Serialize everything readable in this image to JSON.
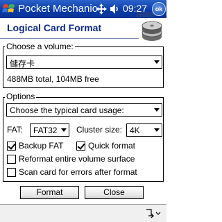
{
  "taskbar": {
    "app_title": "Pocket Mechanic",
    "clock": "09:27",
    "ok_label": "ok"
  },
  "header": {
    "title": "Logical Card Format"
  },
  "volume_group": {
    "legend": "Choose a volume:",
    "selected_volume": "儲存卡",
    "info": "488MB total, 104MB free"
  },
  "options_group": {
    "legend": "Options",
    "usage_select": "Choose the typical card usage:",
    "fat_label": "FAT:",
    "fat_value": "FAT32",
    "cluster_label": "Cluster size:",
    "cluster_value": "4K",
    "backup_fat": {
      "label": "Backup FAT",
      "checked": true
    },
    "quick_format": {
      "label": "Quick format",
      "checked": true
    },
    "reformat_surface": {
      "label": "Reformat entire volume surface",
      "checked": false
    },
    "scan_errors": {
      "label": "Scan card for errors after format",
      "checked": false
    }
  },
  "actions": {
    "format_label": "Format",
    "close_label": "Close"
  },
  "colors": {
    "titlebar": "#0a3aa8",
    "header_text": "#0b2a8c"
  },
  "icons": [
    "windows-start-icon",
    "connectivity-icon",
    "volume-icon",
    "ok-icon",
    "disk-stack-icon",
    "keyboard-sip-icon"
  ]
}
